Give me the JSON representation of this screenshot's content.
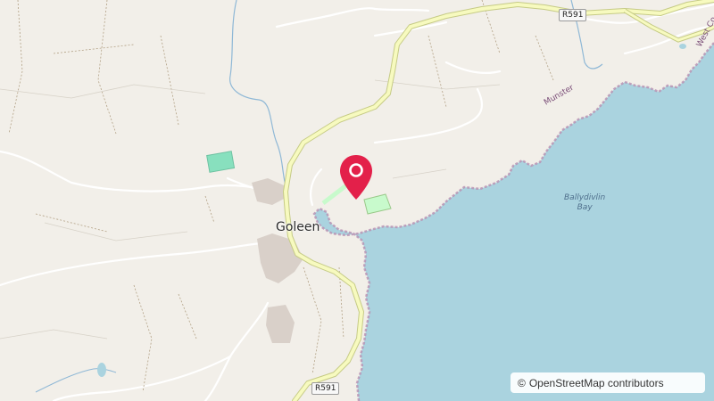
{
  "map": {
    "place_name": "Goleen",
    "bay_line1": "Ballydivlin",
    "bay_line2": "Bay",
    "region_munster": "Munster",
    "region_westcork": "West Co",
    "road_shield_top": "R591",
    "road_shield_bottom": "R591",
    "attribution_symbol": "©",
    "attribution_text": "OpenStreetMap contributors"
  },
  "colors": {
    "land": "#f2efe9",
    "sea": "#aad3df",
    "secondary_road": "#f7fabf",
    "road_casing": "#c6cb86",
    "marker": "#e3204a",
    "park": "#c8facc",
    "pitch": "#88e0be",
    "coastline_boundary": "#b790b2"
  },
  "marker": {
    "icon": "map-pin-icon"
  }
}
